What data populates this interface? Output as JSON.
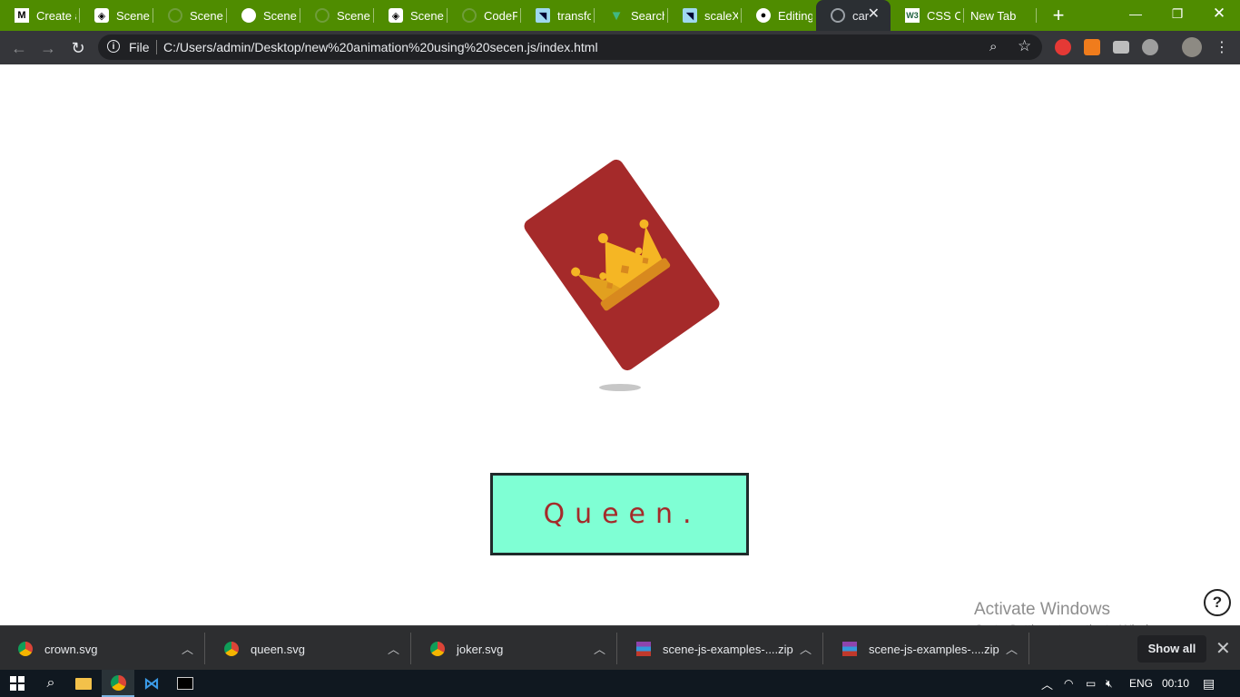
{
  "tabs": [
    {
      "title": "Create a",
      "favicon": "M"
    },
    {
      "title": "Scene.js",
      "favicon": "codepen"
    },
    {
      "title": "Scene.js",
      "favicon": "globe"
    },
    {
      "title": "Scene.js",
      "favicon": "chrome"
    },
    {
      "title": "Scene -",
      "favicon": "globe"
    },
    {
      "title": "Scene.js",
      "favicon": "codepen"
    },
    {
      "title": "CodePe",
      "favicon": "globe"
    },
    {
      "title": "transfor",
      "favicon": "mdn"
    },
    {
      "title": "Search",
      "favicon": "vue"
    },
    {
      "title": "scaleX()",
      "favicon": "mdn"
    },
    {
      "title": "Editing",
      "favicon": "github"
    },
    {
      "title": "card",
      "favicon": "globe",
      "active": true
    },
    {
      "title": "CSS Col",
      "favicon": "w3"
    },
    {
      "title": "New Tab",
      "favicon": ""
    }
  ],
  "browser": {
    "scheme": "File",
    "url": "C:/Users/admin/Desktop/new%20animation%20using%20secen.js/index.html"
  },
  "page": {
    "card_label": "Queen.",
    "activate_title": "Activate Windows",
    "activate_sub": "Go to Settings to activate Windows.",
    "help": "?",
    "colors": {
      "card": "#a52a2a",
      "crown": "#f5b624",
      "label_bg": "#7fffd4",
      "label_text": "#a52a2a"
    }
  },
  "downloads": [
    {
      "name": "crown.svg",
      "icon": "chrome-icon"
    },
    {
      "name": "queen.svg",
      "icon": "chrome-icon"
    },
    {
      "name": "joker.svg",
      "icon": "chrome-icon"
    },
    {
      "name": "scene-js-examples-....zip",
      "icon": "winrar-icon"
    },
    {
      "name": "scene-js-examples-....zip",
      "icon": "winrar-icon"
    }
  ],
  "shelf": {
    "show_all": "Show all"
  },
  "taskbar": {
    "language": "ENG",
    "time": "00:10"
  }
}
